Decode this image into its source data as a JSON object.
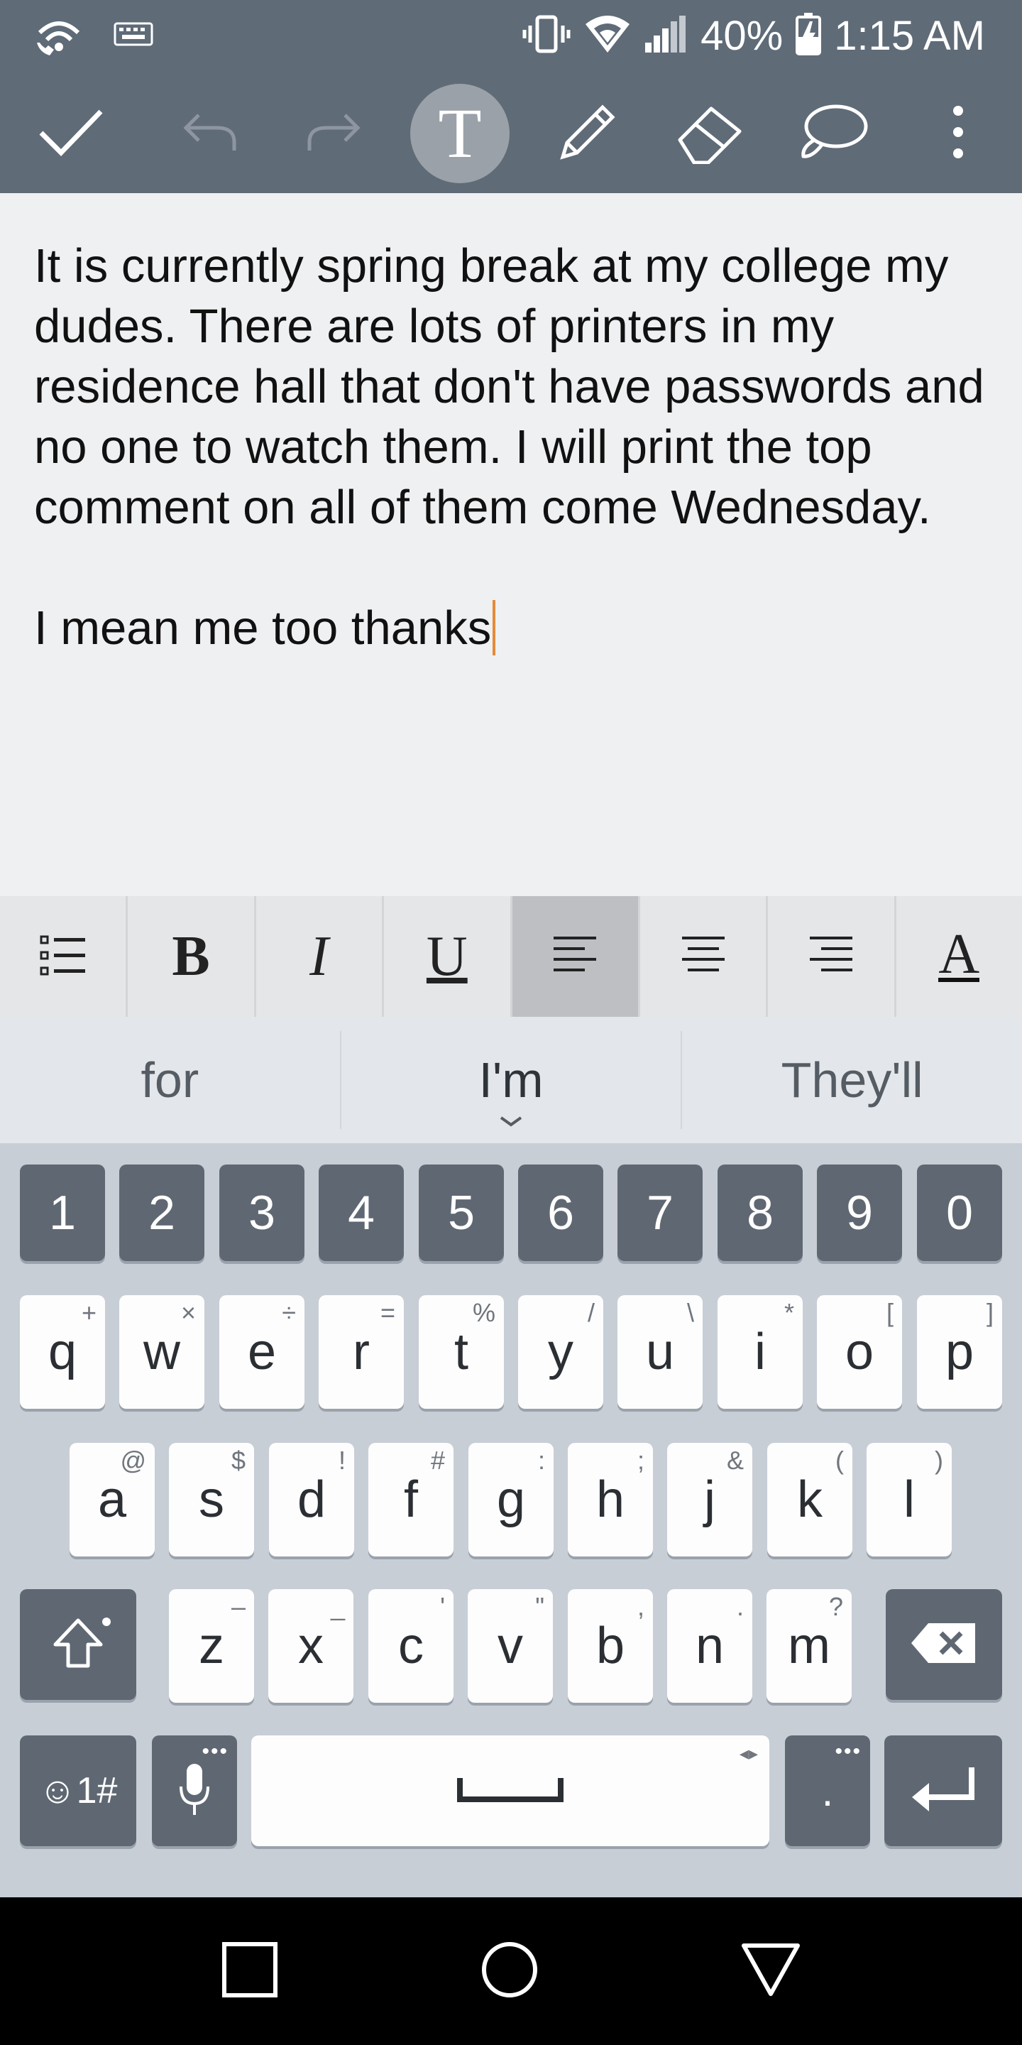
{
  "status_bar": {
    "battery": "40%",
    "time": "1:15 AM"
  },
  "toolbar": {
    "icons": [
      "check-icon",
      "undo-icon",
      "redo-icon",
      "text-mode-icon",
      "pencil-icon",
      "eraser-icon",
      "comment-icon",
      "more-icon"
    ],
    "text_mode_label": "T"
  },
  "editor": {
    "text": "It is currently spring break at my college my dudes. There are lots of printers in my residence hall that don't have passwords and no one to watch them. I will print the top comment on all of them come Wednesday.\n\nI mean me too thanks"
  },
  "format_bar": {
    "bold": "B",
    "italic": "I",
    "underline": "U",
    "font_color": "A",
    "active": "align-left"
  },
  "suggestions": [
    "for",
    "I'm",
    "They'll"
  ],
  "keyboard": {
    "numbers": [
      "1",
      "2",
      "3",
      "4",
      "5",
      "6",
      "7",
      "8",
      "9",
      "0"
    ],
    "row1": [
      {
        "k": "q",
        "h": "+"
      },
      {
        "k": "w",
        "h": "×"
      },
      {
        "k": "e",
        "h": "÷"
      },
      {
        "k": "r",
        "h": "="
      },
      {
        "k": "t",
        "h": "%"
      },
      {
        "k": "y",
        "h": "/"
      },
      {
        "k": "u",
        "h": "\\"
      },
      {
        "k": "i",
        "h": "*"
      },
      {
        "k": "o",
        "h": "["
      },
      {
        "k": "p",
        "h": "]"
      }
    ],
    "row2": [
      {
        "k": "a",
        "h": "@"
      },
      {
        "k": "s",
        "h": "$"
      },
      {
        "k": "d",
        "h": "!"
      },
      {
        "k": "f",
        "h": "#"
      },
      {
        "k": "g",
        "h": ":"
      },
      {
        "k": "h",
        "h": ";"
      },
      {
        "k": "j",
        "h": "&"
      },
      {
        "k": "k",
        "h": "("
      },
      {
        "k": "l",
        "h": ")"
      }
    ],
    "row3": [
      {
        "k": "z",
        "h": "–"
      },
      {
        "k": "x",
        "h": "_"
      },
      {
        "k": "c",
        "h": "'"
      },
      {
        "k": "v",
        "h": "\""
      },
      {
        "k": "b",
        "h": ","
      },
      {
        "k": "n",
        "h": "."
      },
      {
        "k": "m",
        "h": "?"
      }
    ],
    "symbols_label": "☺1#",
    "period_label": "."
  }
}
